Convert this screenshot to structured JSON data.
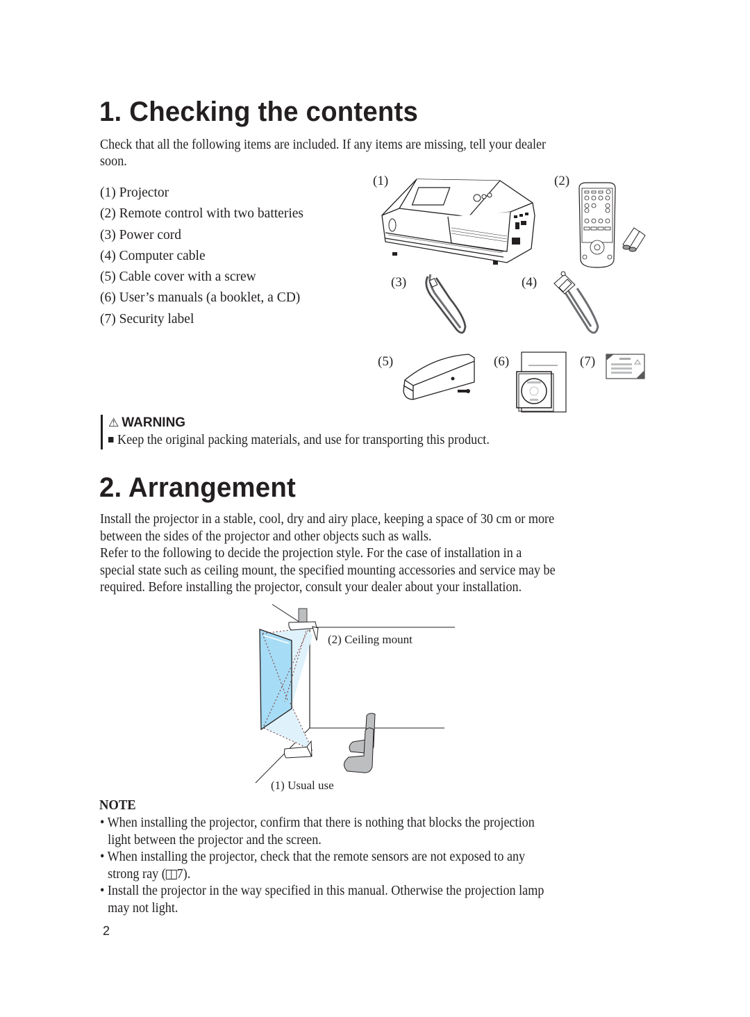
{
  "section1": {
    "title": "1. Checking the contents",
    "intro_line1": "Check that all the following items are included. If any items are missing, tell your dealer",
    "intro_line2": "soon.",
    "items": [
      {
        "num": "(1)",
        "label": "Projector"
      },
      {
        "num": "(2)",
        "label": "Remote control with two batteries"
      },
      {
        "num": "(3)",
        "label": "Power cord"
      },
      {
        "num": "(4)",
        "label": "Computer cable"
      },
      {
        "num": "(5)",
        "label": "Cable cover with a screw"
      },
      {
        "num": "(6)",
        "label": "User’s manuals (a booklet, a CD)"
      },
      {
        "num": "(7)",
        "label": "Security label"
      }
    ],
    "figure_labels": [
      "(1)",
      "(2)",
      "(3)",
      "(4)",
      "(5)",
      "(6)",
      "(7)"
    ]
  },
  "warning": {
    "icon": "warning-triangle-icon",
    "title": "WARNING",
    "bullet_icon": "square-bullet-icon",
    "text": "Keep the original packing materials, and use for transporting this product."
  },
  "section2": {
    "title": "2. Arrangement",
    "paragraph_lines": [
      "Install the projector in a stable, cool, dry and airy place, keeping a space of 30 cm or more",
      "between the sides of the projector and other objects such as walls.",
      "Refer to the following to decide the projection style. For the case of installation in a",
      "special state such as ceiling mount, the specified mounting accessories and service may be",
      "required. Before installing the projector, consult your dealer about your installation."
    ],
    "diagram": {
      "caption_ceiling": "(2) Ceiling mount",
      "caption_usual": "(1) Usual use",
      "screen_color": "#a6dcf5",
      "beam_color": "#dff2fb",
      "chair_color": "#bcbec0"
    }
  },
  "note": {
    "title": "NOTE",
    "bullets": [
      {
        "line1": "When installing the projector, confirm that there is nothing that blocks the projection",
        "line2": "light between the projector and the screen."
      },
      {
        "line1": "When installing the projector, check that the remote sensors are not exposed to any",
        "line2_pre": "strong ray (",
        "ref_icon": "book-reference-icon",
        "line2_post": "7)."
      },
      {
        "line1": "Install the projector in the way specified in this manual. Otherwise the projection lamp",
        "line2": "may not light."
      }
    ]
  },
  "page_number": "2"
}
